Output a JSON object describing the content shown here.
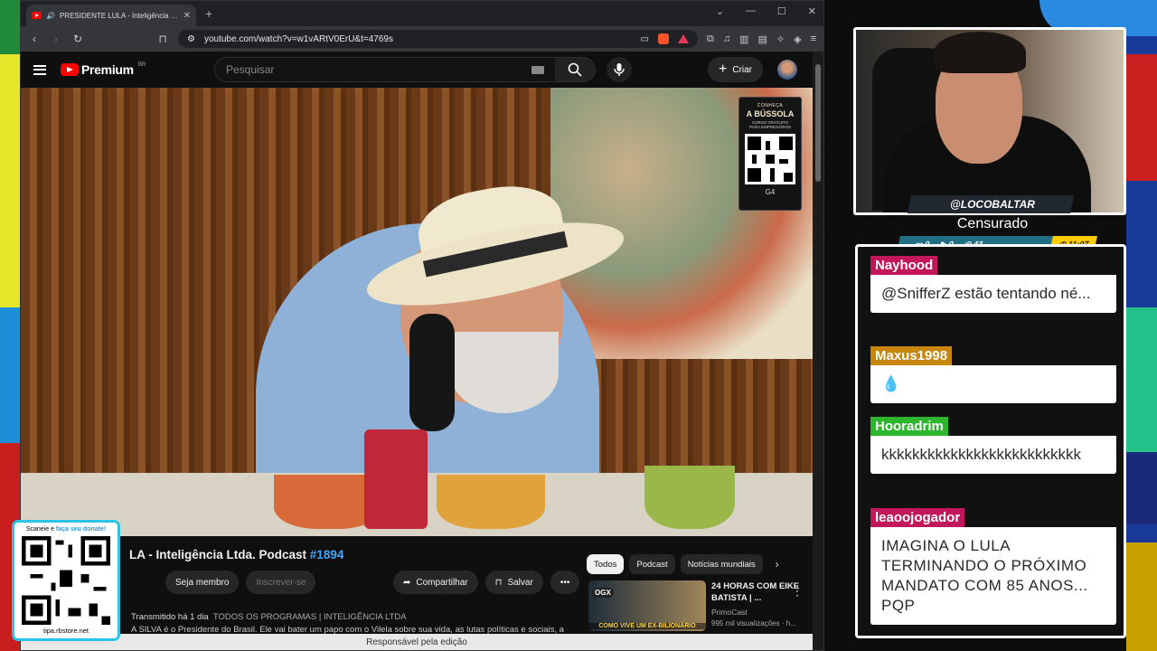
{
  "browser": {
    "tab_title": "PRESIDENTE LULA - Inteligência Ltda.",
    "url": "youtube.com/watch?v=w1vARtV0ErU&t=4769s"
  },
  "youtube": {
    "logo": "Premium",
    "logo_region": "BR",
    "search_placeholder": "Pesquisar",
    "create_label": "Criar",
    "video_title_prefix": "LA - Inteligência Ltda. Podcast",
    "video_title_tag": "#1894",
    "member_label": "Seja membro",
    "subscribe_label": "Inscrever-se",
    "share_label": "Compartilhar",
    "save_label": "Salvar",
    "meta_streamed": "Transmitido há 1 dia",
    "meta_tags": "TODOS OS PROGRAMAS | INTELIGÊNCIA LTDA",
    "description": "A SILVA é o Presidente do Brasil. Ele vai bater um papo com o Vilela sobre sua vida, as lutas políticas e sociais, a",
    "chips": [
      "Todos",
      "Podcast",
      "Notícias mundiais"
    ],
    "rec": {
      "title": "24 HORAS COM EIKE BATISTA | ...",
      "channel": "PrimoCast",
      "views": "995 mil visualizações · h...",
      "thumb_badge": "OGX",
      "thumb_caption": "COMO VIVE UM EX-BILIONÁRIO"
    },
    "status_bar": "Responsável pela edição",
    "card": {
      "line1": "CONHEÇA",
      "line2": "A BÚSSOLA",
      "line3": "CURSO GRATUITO",
      "line4": "PARA EMPRESÁRIOS",
      "brand": "G4"
    }
  },
  "donate": {
    "top_prefix": "Scaneie e",
    "top_highlight": "faça seu donate!",
    "site": "tipa.rbstore.net"
  },
  "stream": {
    "handle": "@LOCOBALTAR",
    "title": "Censurado",
    "stats": [
      "0",
      "0",
      "43"
    ],
    "clock": "11:07"
  },
  "chat": [
    {
      "user": "Nayhood",
      "color": "#c2185b",
      "text": "@SnifferZ estão tentando né..."
    },
    {
      "user": "Maxus1998",
      "color": "#c8860d",
      "text": "💧"
    },
    {
      "user": "Hooradrim",
      "color": "#2db52d",
      "text": "kkkkkkkkkkkkkkkkkkkkkkkkkk"
    },
    {
      "user": "leaoojogador",
      "color": "#c2185b",
      "text": "IMAGINA O LULA TERMINANDO O PRÓXIMO MANDATO COM 85 ANOS... PQP"
    }
  ]
}
